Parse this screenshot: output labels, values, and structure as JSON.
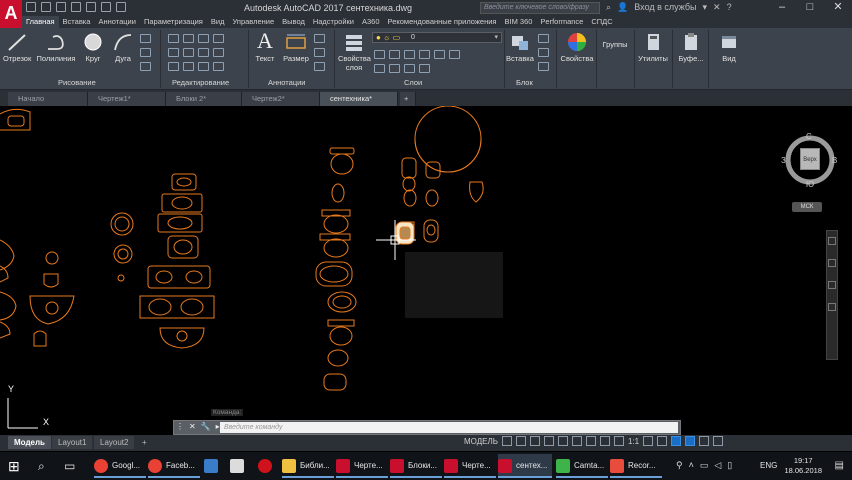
{
  "titlebar": {
    "title": "Autodesk AutoCAD 2017    сентехника.dwg",
    "logo": "A",
    "search_placeholder": "Введите ключевое слово/фразу",
    "login": "Вход в службы",
    "minimize": "–",
    "maximize": "□",
    "close": "✕"
  },
  "ribbon_tabs": [
    "Главная",
    "Вставка",
    "Аннотации",
    "Параметризация",
    "Вид",
    "Управление",
    "Вывод",
    "Надстройки",
    "A360",
    "Рекомендованные приложения",
    "BIM 360",
    "Performance",
    "СПДС"
  ],
  "ribbon": {
    "draw": {
      "line": "Отрезок",
      "polyline": "Полилиния",
      "circle": "Круг",
      "arc": "Дуга",
      "label": "Рисование"
    },
    "modify_label": "Редактирование",
    "annotation": {
      "text": "Текст",
      "dimension": "Размер",
      "label": "Аннотации"
    },
    "layers": {
      "properties_line1": "Свойства",
      "properties_line2": "слоя",
      "current_layer": "0",
      "label": "Слои"
    },
    "block": {
      "insert": "Вставка",
      "label": "Блок"
    },
    "properties": "Свойства",
    "groups": "Группы",
    "utilities": "Утилиты",
    "clipboard": "Буфе...",
    "view": "Вид"
  },
  "file_tabs": [
    {
      "label": "Начало",
      "active": false
    },
    {
      "label": "Чертеж1*",
      "active": false
    },
    {
      "label": "Блоки 2*",
      "active": false
    },
    {
      "label": "Чертеж2*",
      "active": false
    },
    {
      "label": "сентехника*",
      "active": true
    }
  ],
  "viewcube": {
    "north": "С",
    "south": "Ю",
    "east": "В",
    "west": "З",
    "face": "Верх",
    "wcs": "МСК"
  },
  "ucs": {
    "x": "X",
    "y": "Y"
  },
  "command": {
    "hint": "Команда:",
    "placeholder": "Введите команду"
  },
  "layout_tabs": [
    {
      "label": "Модель",
      "active": true
    },
    {
      "label": "Layout1",
      "active": false
    },
    {
      "label": "Layout2",
      "active": false
    }
  ],
  "status": {
    "mode": "МОДЕЛЬ",
    "scale": "1:1"
  },
  "taskbar": {
    "items": [
      "Googl...",
      "Faceb...",
      "Библи...",
      "Черте...",
      "Блоки...",
      "Черте...",
      "сентех...",
      "Camta...",
      "Recor..."
    ],
    "lang": "ENG",
    "time": "19:17",
    "date": "18.06.2018"
  },
  "colors": {
    "accent": "#1a6fc4",
    "drawing": "#e87a1e",
    "canvas": "#000000",
    "ribbon": "#3d434c"
  }
}
